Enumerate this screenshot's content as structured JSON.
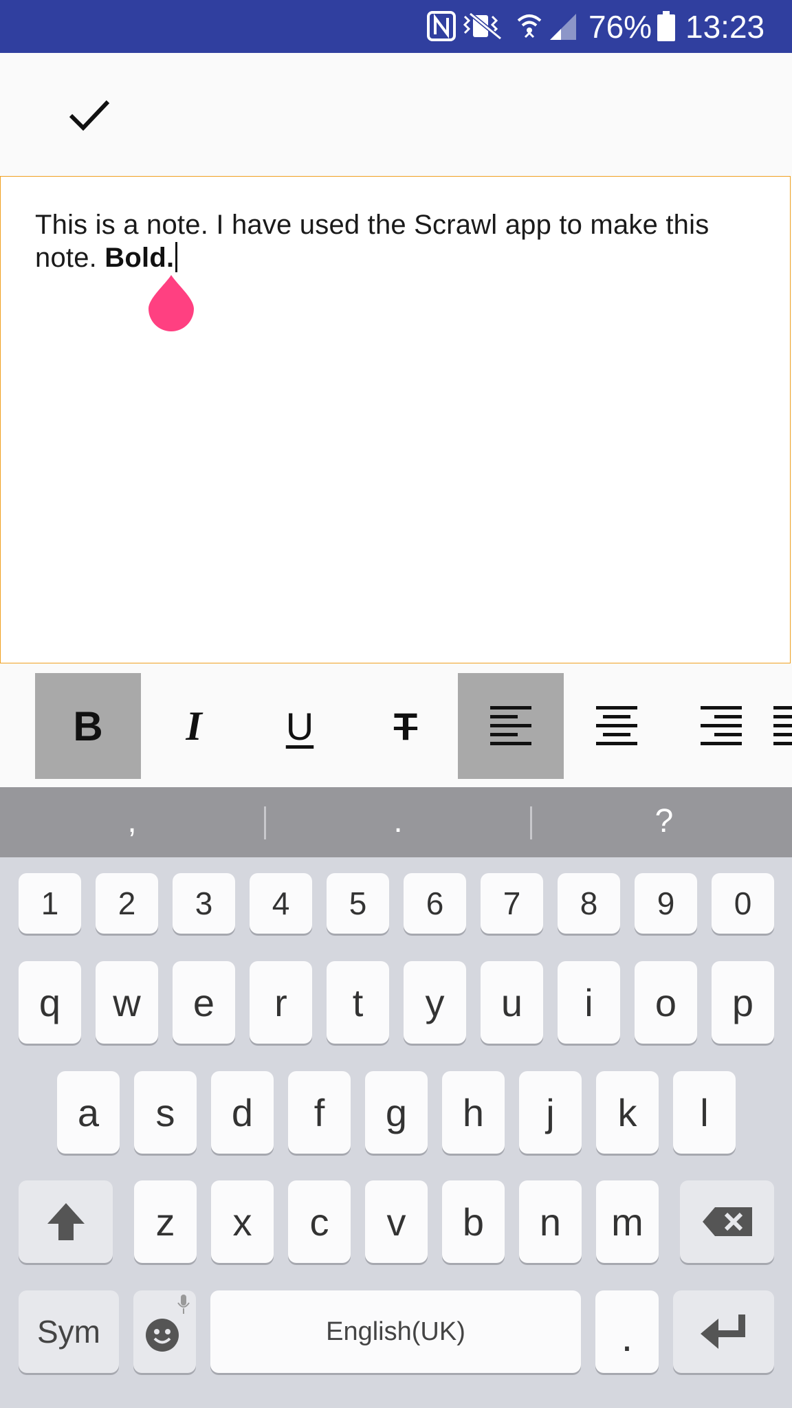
{
  "status_bar": {
    "battery": "76%",
    "time": "13:23",
    "icons": [
      "nfc-icon",
      "vibrate-icon",
      "wifi-icon",
      "signal-icon",
      "battery-icon"
    ],
    "background": "#303f9f"
  },
  "toolbar": {
    "done_icon": "check-icon"
  },
  "note": {
    "text_plain": "This is a note. I have used the Scrawl app to make this note. ",
    "text_bold": "Bold.",
    "border_color": "#f0a020",
    "handle_color": "#ff4081"
  },
  "format_bar": {
    "buttons": [
      {
        "name": "bold",
        "label": "B",
        "active": true
      },
      {
        "name": "italic",
        "label": "I",
        "active": false
      },
      {
        "name": "underline",
        "label": "U",
        "active": false
      },
      {
        "name": "strikethrough",
        "label": "T",
        "active": false
      },
      {
        "name": "align-left",
        "label": "",
        "active": true
      },
      {
        "name": "align-center",
        "label": "",
        "active": false
      },
      {
        "name": "align-right",
        "label": "",
        "active": false
      },
      {
        "name": "align-justify",
        "label": "",
        "active": false
      }
    ]
  },
  "keyboard": {
    "suggestions": [
      ",",
      ".",
      "?"
    ],
    "number_row": [
      "1",
      "2",
      "3",
      "4",
      "5",
      "6",
      "7",
      "8",
      "9",
      "0"
    ],
    "row1": [
      "q",
      "w",
      "e",
      "r",
      "t",
      "y",
      "u",
      "i",
      "o",
      "p"
    ],
    "row2": [
      "a",
      "s",
      "d",
      "f",
      "g",
      "h",
      "j",
      "k",
      "l"
    ],
    "row3": [
      "z",
      "x",
      "c",
      "v",
      "b",
      "n",
      "m"
    ],
    "sym_label": "Sym",
    "space_label": "English(UK)",
    "period_label": "."
  }
}
